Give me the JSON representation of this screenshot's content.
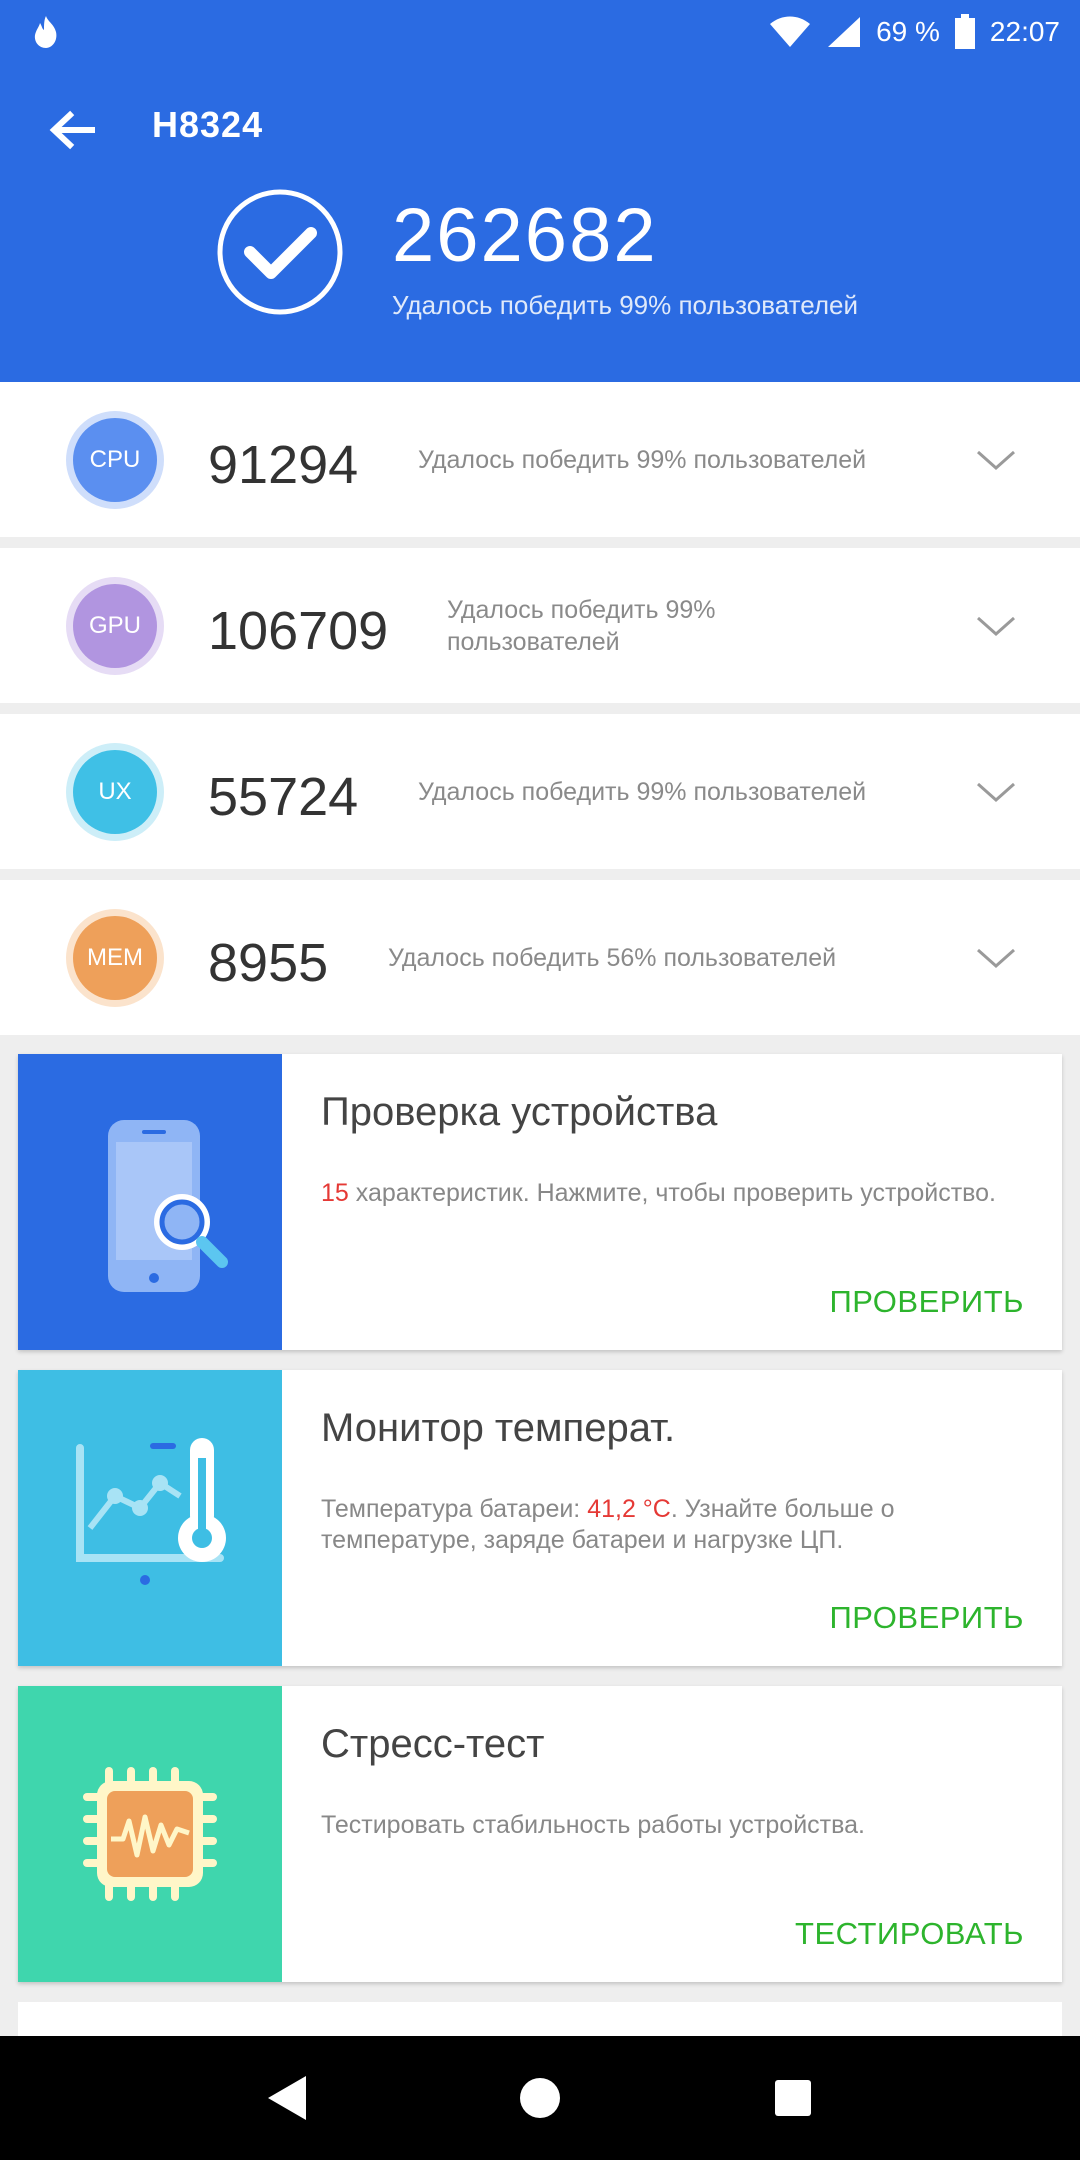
{
  "status_bar": {
    "battery_percent": "69 %",
    "time": "22:07",
    "icons": [
      "flame-icon",
      "wifi-icon",
      "signal-icon",
      "battery-icon"
    ]
  },
  "header": {
    "device": "H8324",
    "total_score": "262682",
    "total_desc": "Удалось победить 99% пользователей"
  },
  "scores": [
    {
      "badge": "CPU",
      "value": "91294",
      "desc": "Удалось победить 99% пользователей",
      "color": "#5b8ff0",
      "ring": "#cfdefb"
    },
    {
      "badge": "GPU",
      "value": "106709",
      "desc": "Удалось победить 99% пользователей",
      "color": "#b195e0",
      "ring": "#e6dcf5"
    },
    {
      "badge": "UX",
      "value": "55724",
      "desc": "Удалось победить 99% пользователей",
      "color": "#3fc0e6",
      "ring": "#cdeef8"
    },
    {
      "badge": "MEM",
      "value": "8955",
      "desc": "Удалось победить 56% пользователей",
      "color": "#eea05a",
      "ring": "#fbe3cc"
    }
  ],
  "cards": [
    {
      "title": "Проверка устройства",
      "desc_highlight": "15",
      "desc_rest": " характеристик. Нажмите, чтобы проверить устройство.",
      "action": "ПРОВЕРИТЬ",
      "bg": "#2b6be2"
    },
    {
      "title": "Монитор температ.",
      "desc_prefix": "Температура батареи: ",
      "desc_highlight": "41,2 °C",
      "desc_rest": ". Узнайте больше о температуре, заряде батареи и нагрузке ЦП.",
      "action": "ПРОВЕРИТЬ",
      "bg": "#3ebee4"
    },
    {
      "title": "Стресс-тест",
      "desc_rest": "Тестировать стабильность работы устройства.",
      "action": "ТЕСТИРОВАТЬ",
      "bg": "#3fd6ad"
    }
  ],
  "colors": {
    "accent": "#2b6be2",
    "action_green": "#2db42d",
    "highlight_red": "#e53935"
  }
}
